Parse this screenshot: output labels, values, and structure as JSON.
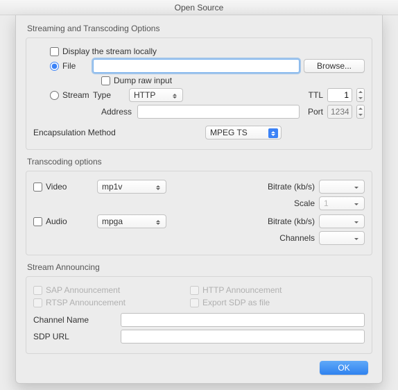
{
  "window": {
    "title": "Open Source"
  },
  "streaming": {
    "group_title": "Streaming and Transcoding Options",
    "display_locally": {
      "label": "Display the stream locally",
      "checked": false
    },
    "file": {
      "label": "File",
      "selected": true,
      "path": "",
      "browse_label": "Browse...",
      "dump_raw": {
        "label": "Dump raw input",
        "checked": false
      }
    },
    "stream": {
      "label": "Stream",
      "selected": false,
      "type_label": "Type",
      "type_value": "HTTP",
      "ttl_label": "TTL",
      "ttl_value": "1",
      "address_label": "Address",
      "address_value": "",
      "port_label": "Port",
      "port_placeholder": "1234"
    },
    "encapsulation": {
      "label": "Encapsulation Method",
      "value": "MPEG TS"
    }
  },
  "transcoding": {
    "group_title": "Transcoding options",
    "video": {
      "label": "Video",
      "checked": false,
      "codec": "mp1v",
      "bitrate_label": "Bitrate (kb/s)",
      "bitrate_value": "",
      "scale_label": "Scale",
      "scale_value": "1"
    },
    "audio": {
      "label": "Audio",
      "checked": false,
      "codec": "mpga",
      "bitrate_label": "Bitrate (kb/s)",
      "bitrate_value": "",
      "channels_label": "Channels",
      "channels_value": ""
    }
  },
  "announcing": {
    "group_title": "Stream Announcing",
    "sap": {
      "label": "SAP Announcement",
      "checked": false
    },
    "rtsp": {
      "label": "RTSP Announcement",
      "checked": false
    },
    "http": {
      "label": "HTTP Announcement",
      "checked": false
    },
    "export_sdp": {
      "label": "Export SDP as file",
      "checked": false
    },
    "channel_name": {
      "label": "Channel Name",
      "value": ""
    },
    "sdp_url": {
      "label": "SDP URL",
      "value": ""
    }
  },
  "buttons": {
    "ok": "OK"
  }
}
